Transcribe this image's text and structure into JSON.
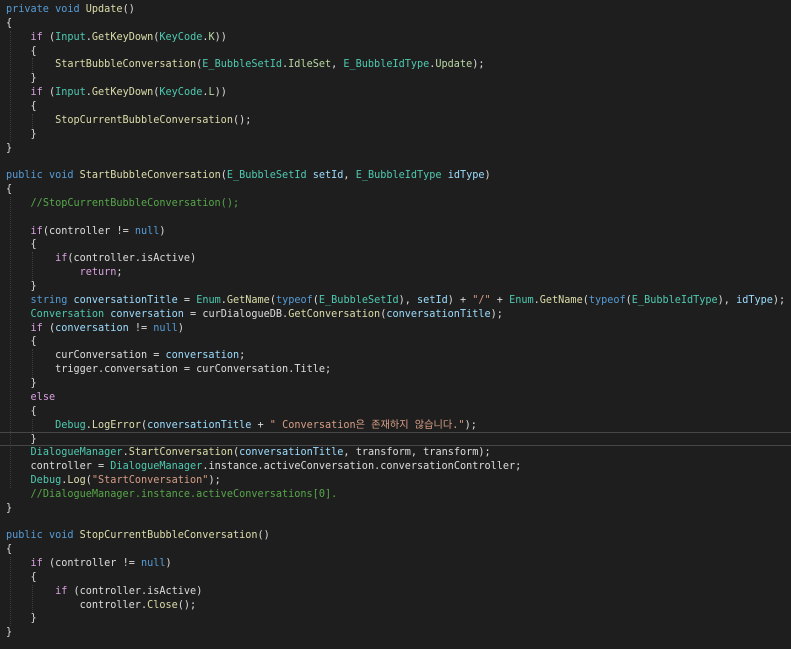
{
  "editor": {
    "current_line": 31,
    "lines": [
      [
        [
          "kw",
          "private"
        ],
        [
          "plain",
          " "
        ],
        [
          "kw",
          "void"
        ],
        [
          "plain",
          " "
        ],
        [
          "method",
          "Update"
        ],
        [
          "plain",
          "()"
        ]
      ],
      [
        [
          "plain",
          "{"
        ]
      ],
      [
        [
          "plain",
          "    "
        ],
        [
          "ctrl",
          "if"
        ],
        [
          "plain",
          " ("
        ],
        [
          "type",
          "Input"
        ],
        [
          "plain",
          "."
        ],
        [
          "method",
          "GetKeyDown"
        ],
        [
          "plain",
          "("
        ],
        [
          "type",
          "KeyCode"
        ],
        [
          "plain",
          "."
        ],
        [
          "enum",
          "K"
        ],
        [
          "plain",
          "))"
        ]
      ],
      [
        [
          "plain",
          "    {"
        ]
      ],
      [
        [
          "plain",
          "        "
        ],
        [
          "method",
          "StartBubbleConversation"
        ],
        [
          "plain",
          "("
        ],
        [
          "type",
          "E_BubbleSetId"
        ],
        [
          "plain",
          "."
        ],
        [
          "enum",
          "IdleSet"
        ],
        [
          "plain",
          ", "
        ],
        [
          "type",
          "E_BubbleIdType"
        ],
        [
          "plain",
          "."
        ],
        [
          "enum",
          "Update"
        ],
        [
          "plain",
          ");"
        ]
      ],
      [
        [
          "plain",
          "    }"
        ]
      ],
      [
        [
          "plain",
          "    "
        ],
        [
          "ctrl",
          "if"
        ],
        [
          "plain",
          " ("
        ],
        [
          "type",
          "Input"
        ],
        [
          "plain",
          "."
        ],
        [
          "method",
          "GetKeyDown"
        ],
        [
          "plain",
          "("
        ],
        [
          "type",
          "KeyCode"
        ],
        [
          "plain",
          "."
        ],
        [
          "enum",
          "L"
        ],
        [
          "plain",
          "))"
        ]
      ],
      [
        [
          "plain",
          "    {"
        ]
      ],
      [
        [
          "plain",
          "        "
        ],
        [
          "method",
          "StopCurrentBubbleConversation"
        ],
        [
          "plain",
          "();"
        ]
      ],
      [
        [
          "plain",
          "    }"
        ]
      ],
      [
        [
          "plain",
          "}"
        ]
      ],
      [],
      [
        [
          "kw",
          "public"
        ],
        [
          "plain",
          " "
        ],
        [
          "kw",
          "void"
        ],
        [
          "plain",
          " "
        ],
        [
          "method",
          "StartBubbleConversation"
        ],
        [
          "plain",
          "("
        ],
        [
          "type",
          "E_BubbleSetId"
        ],
        [
          "plain",
          " "
        ],
        [
          "param",
          "setId"
        ],
        [
          "plain",
          ", "
        ],
        [
          "type",
          "E_BubbleIdType"
        ],
        [
          "plain",
          " "
        ],
        [
          "param",
          "idType"
        ],
        [
          "plain",
          ")"
        ]
      ],
      [
        [
          "plain",
          "{"
        ]
      ],
      [
        [
          "plain",
          "    "
        ],
        [
          "comment",
          "//StopCurrentBubbleConversation();"
        ]
      ],
      [],
      [
        [
          "plain",
          "    "
        ],
        [
          "ctrl",
          "if"
        ],
        [
          "plain",
          "("
        ],
        [
          "plain",
          "controller"
        ],
        [
          "plain",
          " != "
        ],
        [
          "kw",
          "null"
        ],
        [
          "plain",
          ")"
        ]
      ],
      [
        [
          "plain",
          "    {"
        ]
      ],
      [
        [
          "plain",
          "        "
        ],
        [
          "ctrl",
          "if"
        ],
        [
          "plain",
          "("
        ],
        [
          "plain",
          "controller"
        ],
        [
          "plain",
          "."
        ],
        [
          "plain",
          "isActive"
        ],
        [
          "plain",
          ")"
        ]
      ],
      [
        [
          "plain",
          "            "
        ],
        [
          "ctrl",
          "return"
        ],
        [
          "plain",
          ";"
        ]
      ],
      [
        [
          "plain",
          "    }"
        ]
      ],
      [
        [
          "plain",
          "    "
        ],
        [
          "kw",
          "string"
        ],
        [
          "plain",
          " "
        ],
        [
          "local",
          "conversationTitle"
        ],
        [
          "plain",
          " = "
        ],
        [
          "type",
          "Enum"
        ],
        [
          "plain",
          "."
        ],
        [
          "method",
          "GetName"
        ],
        [
          "plain",
          "("
        ],
        [
          "kw",
          "typeof"
        ],
        [
          "plain",
          "("
        ],
        [
          "type",
          "E_BubbleSetId"
        ],
        [
          "plain",
          "), "
        ],
        [
          "param",
          "setId"
        ],
        [
          "plain",
          ") + "
        ],
        [
          "string",
          "\"/\""
        ],
        [
          "plain",
          " + "
        ],
        [
          "type",
          "Enum"
        ],
        [
          "plain",
          "."
        ],
        [
          "method",
          "GetName"
        ],
        [
          "plain",
          "("
        ],
        [
          "kw",
          "typeof"
        ],
        [
          "plain",
          "("
        ],
        [
          "type",
          "E_BubbleIdType"
        ],
        [
          "plain",
          "), "
        ],
        [
          "param",
          "idType"
        ],
        [
          "plain",
          ");"
        ]
      ],
      [
        [
          "plain",
          "    "
        ],
        [
          "type",
          "Conversation"
        ],
        [
          "plain",
          " "
        ],
        [
          "local",
          "conversation"
        ],
        [
          "plain",
          " = "
        ],
        [
          "plain",
          "curDialogueDB"
        ],
        [
          "plain",
          "."
        ],
        [
          "method",
          "GetConversation"
        ],
        [
          "plain",
          "("
        ],
        [
          "local",
          "conversationTitle"
        ],
        [
          "plain",
          ");"
        ]
      ],
      [
        [
          "plain",
          "    "
        ],
        [
          "ctrl",
          "if"
        ],
        [
          "plain",
          " ("
        ],
        [
          "local",
          "conversation"
        ],
        [
          "plain",
          " != "
        ],
        [
          "kw",
          "null"
        ],
        [
          "plain",
          ")"
        ]
      ],
      [
        [
          "plain",
          "    {"
        ]
      ],
      [
        [
          "plain",
          "        "
        ],
        [
          "plain",
          "curConversation"
        ],
        [
          "plain",
          " = "
        ],
        [
          "local",
          "conversation"
        ],
        [
          "plain",
          ";"
        ]
      ],
      [
        [
          "plain",
          "        "
        ],
        [
          "plain",
          "trigger"
        ],
        [
          "plain",
          "."
        ],
        [
          "plain",
          "conversation"
        ],
        [
          "plain",
          " = "
        ],
        [
          "plain",
          "curConversation"
        ],
        [
          "plain",
          "."
        ],
        [
          "plain",
          "Title"
        ],
        [
          "plain",
          ";"
        ]
      ],
      [
        [
          "plain",
          "    }"
        ]
      ],
      [
        [
          "plain",
          "    "
        ],
        [
          "ctrl",
          "else"
        ]
      ],
      [
        [
          "plain",
          "    {"
        ]
      ],
      [
        [
          "plain",
          "        "
        ],
        [
          "type",
          "Debug"
        ],
        [
          "plain",
          "."
        ],
        [
          "method",
          "LogError"
        ],
        [
          "plain",
          "("
        ],
        [
          "local",
          "conversationTitle"
        ],
        [
          "plain",
          " + "
        ],
        [
          "string",
          "\" Conversation은 존재하지 않습니다.\""
        ],
        [
          "plain",
          ");"
        ]
      ],
      [
        [
          "plain",
          "    }"
        ]
      ],
      [
        [
          "plain",
          "    "
        ],
        [
          "type",
          "DialogueManager"
        ],
        [
          "plain",
          "."
        ],
        [
          "method",
          "StartConversation"
        ],
        [
          "plain",
          "("
        ],
        [
          "local",
          "conversationTitle"
        ],
        [
          "plain",
          ", "
        ],
        [
          "plain",
          "transform"
        ],
        [
          "plain",
          ", "
        ],
        [
          "plain",
          "transform"
        ],
        [
          "plain",
          ");"
        ]
      ],
      [
        [
          "plain",
          "    "
        ],
        [
          "plain",
          "controller"
        ],
        [
          "plain",
          " = "
        ],
        [
          "type",
          "DialogueManager"
        ],
        [
          "plain",
          "."
        ],
        [
          "plain",
          "instance"
        ],
        [
          "plain",
          "."
        ],
        [
          "plain",
          "activeConversation"
        ],
        [
          "plain",
          "."
        ],
        [
          "plain",
          "conversationController"
        ],
        [
          "plain",
          ";"
        ]
      ],
      [
        [
          "plain",
          "    "
        ],
        [
          "type",
          "Debug"
        ],
        [
          "plain",
          "."
        ],
        [
          "method",
          "Log"
        ],
        [
          "plain",
          "("
        ],
        [
          "string",
          "\"StartConversation\""
        ],
        [
          "plain",
          ");"
        ]
      ],
      [
        [
          "plain",
          "    "
        ],
        [
          "comment",
          "//DialogueManager.instance.activeConversations[0]."
        ]
      ],
      [
        [
          "plain",
          "}"
        ]
      ],
      [],
      [
        [
          "kw",
          "public"
        ],
        [
          "plain",
          " "
        ],
        [
          "kw",
          "void"
        ],
        [
          "plain",
          " "
        ],
        [
          "method",
          "StopCurrentBubbleConversation"
        ],
        [
          "plain",
          "()"
        ]
      ],
      [
        [
          "plain",
          "{"
        ]
      ],
      [
        [
          "plain",
          "    "
        ],
        [
          "ctrl",
          "if"
        ],
        [
          "plain",
          " ("
        ],
        [
          "plain",
          "controller"
        ],
        [
          "plain",
          " != "
        ],
        [
          "kw",
          "null"
        ],
        [
          "plain",
          ")"
        ]
      ],
      [
        [
          "plain",
          "    {"
        ]
      ],
      [
        [
          "plain",
          "        "
        ],
        [
          "ctrl",
          "if"
        ],
        [
          "plain",
          " ("
        ],
        [
          "plain",
          "controller"
        ],
        [
          "plain",
          "."
        ],
        [
          "plain",
          "isActive"
        ],
        [
          "plain",
          ")"
        ]
      ],
      [
        [
          "plain",
          "            "
        ],
        [
          "plain",
          "controller"
        ],
        [
          "plain",
          "."
        ],
        [
          "method",
          "Close"
        ],
        [
          "plain",
          "();"
        ]
      ],
      [
        [
          "plain",
          "    }"
        ]
      ],
      [
        [
          "plain",
          "}"
        ]
      ]
    ]
  }
}
